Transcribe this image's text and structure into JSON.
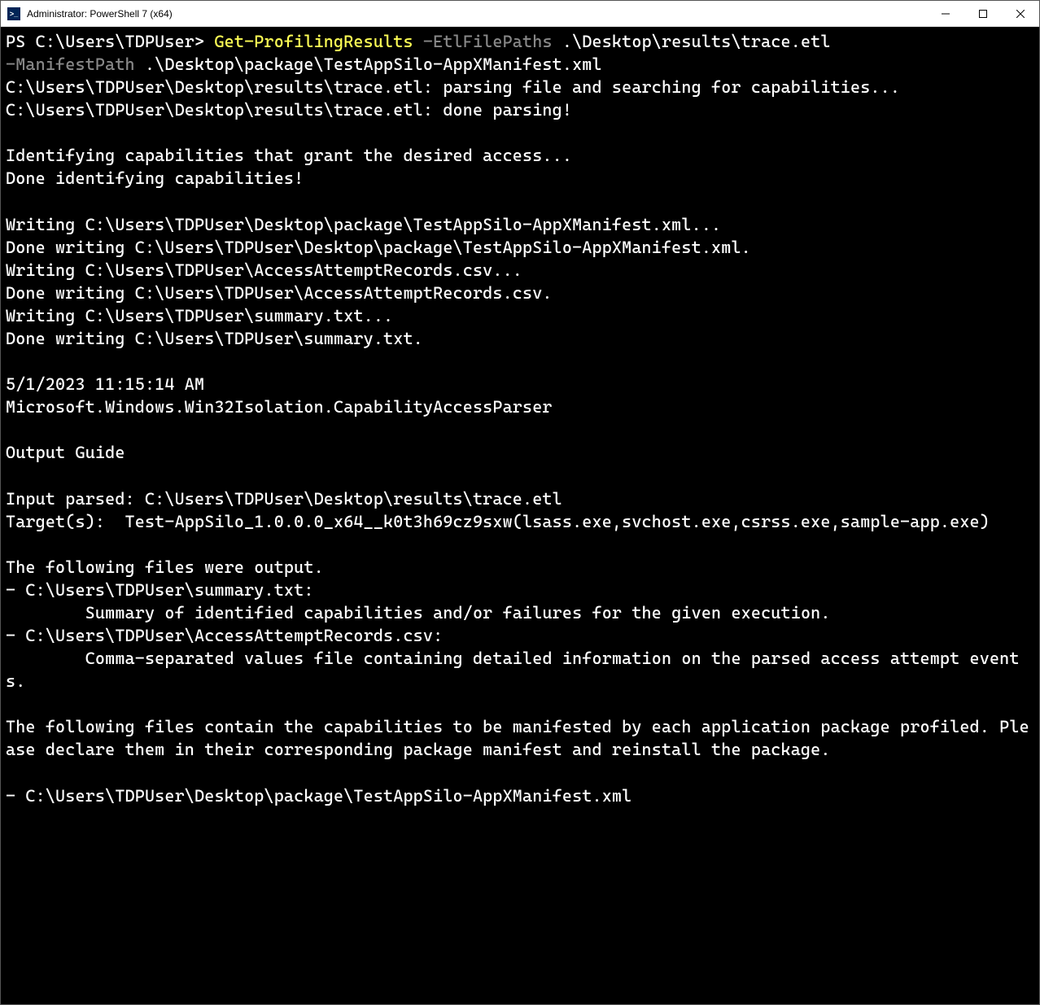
{
  "titlebar": {
    "title": "Administrator: PowerShell 7 (x64)",
    "icon_label": ">_"
  },
  "prompt": {
    "text": "PS C:\\Users\\TDPUser> ",
    "cmdlet": "Get-ProfilingResults",
    "param1": " -EtlFilePaths ",
    "arg1": ".\\Desktop\\results\\trace.etl",
    "param2": "-ManifestPath ",
    "arg2": ".\\Desktop\\package\\TestAppSilo-AppXManifest.xml"
  },
  "output": {
    "l1": "C:\\Users\\TDPUser\\Desktop\\results\\trace.etl: parsing file and searching for capabilities...",
    "l2": "C:\\Users\\TDPUser\\Desktop\\results\\trace.etl: done parsing!",
    "blank1": "",
    "l3": "Identifying capabilities that grant the desired access...",
    "l4": "Done identifying capabilities!",
    "blank2": "",
    "l5": "Writing C:\\Users\\TDPUser\\Desktop\\package\\TestAppSilo-AppXManifest.xml...",
    "l6": "Done writing C:\\Users\\TDPUser\\Desktop\\package\\TestAppSilo-AppXManifest.xml.",
    "l7": "Writing C:\\Users\\TDPUser\\AccessAttemptRecords.csv...",
    "l8": "Done writing C:\\Users\\TDPUser\\AccessAttemptRecords.csv.",
    "l9": "Writing C:\\Users\\TDPUser\\summary.txt...",
    "l10": "Done writing C:\\Users\\TDPUser\\summary.txt.",
    "blank3": "",
    "l11": "5/1/2023 11:15:14 AM",
    "l12": "Microsoft.Windows.Win32Isolation.CapabilityAccessParser",
    "blank4": "",
    "l13": "Output Guide",
    "blank5": "",
    "l14": "Input parsed: C:\\Users\\TDPUser\\Desktop\\results\\trace.etl",
    "l15": "Target(s):  Test-AppSilo_1.0.0.0_x64__k0t3h69cz9sxw(lsass.exe,svchost.exe,csrss.exe,sample-app.exe)",
    "blank6": "",
    "l16": "The following files were output.",
    "l17": "- C:\\Users\\TDPUser\\summary.txt:",
    "l18": "        Summary of identified capabilities and/or failures for the given execution.",
    "l19": "- C:\\Users\\TDPUser\\AccessAttemptRecords.csv:",
    "l20": "        Comma-separated values file containing detailed information on the parsed access attempt events.",
    "blank7": "",
    "l21": "The following files contain the capabilities to be manifested by each application package profiled. Please declare them in their corresponding package manifest and reinstall the package.",
    "blank8": "",
    "l22": "- C:\\Users\\TDPUser\\Desktop\\package\\TestAppSilo-AppXManifest.xml"
  }
}
